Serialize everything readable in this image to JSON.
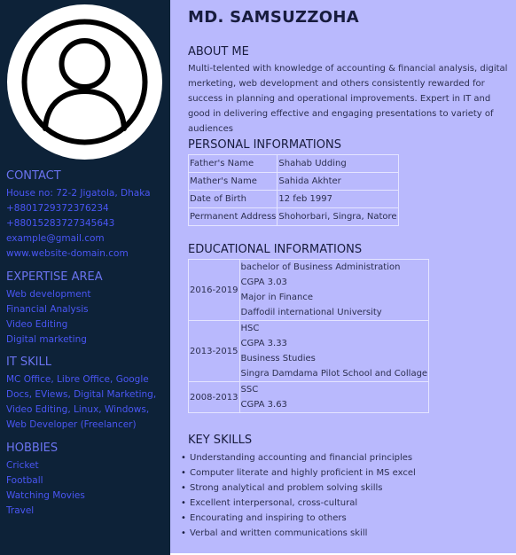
{
  "name": "MD. SAMSUZZOHA",
  "about": {
    "heading": "ABOUT ME",
    "text": "Multi-telented with knowledge of accounting & financial analysis, digital merketing, web development and others consistently rewarded for success in planning and operational improvements. Expert in IT and good in delivering effective and engaging presentations to variety of audiences"
  },
  "personal": {
    "heading": "PERSONAL INFORMATIONS",
    "rows": [
      {
        "label": "Father's Name",
        "value": "Shahab Udding"
      },
      {
        "label": "Mather's Name",
        "value": "Sahida Akhter"
      },
      {
        "label": "Date of Birth",
        "value": "12 feb 1997"
      },
      {
        "label": "Permanent Address",
        "value": "Shohorbari, Singra, Natore"
      }
    ]
  },
  "education": {
    "heading": "EDUCATIONAL INFORMATIONS",
    "rows": [
      {
        "years": "2016-2019",
        "lines": [
          "bachelor of Business Administration",
          "CGPA 3.03",
          "Major in Finance",
          "Daffodil international University"
        ]
      },
      {
        "years": "2013-2015",
        "lines": [
          "HSC",
          "CGPA 3.33",
          "Business Studies",
          "Singra Damdama Pilot School and Collage"
        ]
      },
      {
        "years": "2008-2013",
        "lines": [
          "SSC",
          "CGPA 3.63"
        ]
      }
    ]
  },
  "skills": {
    "heading": "KEY SKILLS",
    "items": [
      "Understanding accounting and financial principles",
      "Computer literate and highly proficient in MS excel",
      "Strong analytical and problem solving skills",
      "Excellent interpersonal, cross-cultural",
      "Encourating and inspiring to others",
      "Verbal and written communications skill"
    ]
  },
  "sidebar": {
    "avatar_icon": "user-avatar-icon",
    "contact": {
      "heading": "CONTACT",
      "lines": [
        "House no: 72-2 Jigatola, Dhaka",
        "+8801729372376234",
        "+88015283727345643",
        "example@gmail.com",
        "www.website-domain.com"
      ]
    },
    "expertise": {
      "heading": "EXPERTISE AREA",
      "lines": [
        "Web development",
        "Financial Analysis",
        "Video Editing",
        "Digital marketing"
      ]
    },
    "it_skill": {
      "heading": "IT SKILL",
      "text": "MC Office, Libre Office, Google Docs, EViews, Digital Marketing, Video Editing, Linux, Windows, Web Developer (Freelancer)"
    },
    "hobbies": {
      "heading": "HOBBIES",
      "lines": [
        "Cricket",
        "Football",
        "Watching Movies",
        "Travel"
      ]
    }
  },
  "colors": {
    "sidebar_bg": "#0d2238",
    "main_bg": "#b9b9fd",
    "link_blue": "#4a56f4",
    "heading_dark": "#181c3e"
  }
}
